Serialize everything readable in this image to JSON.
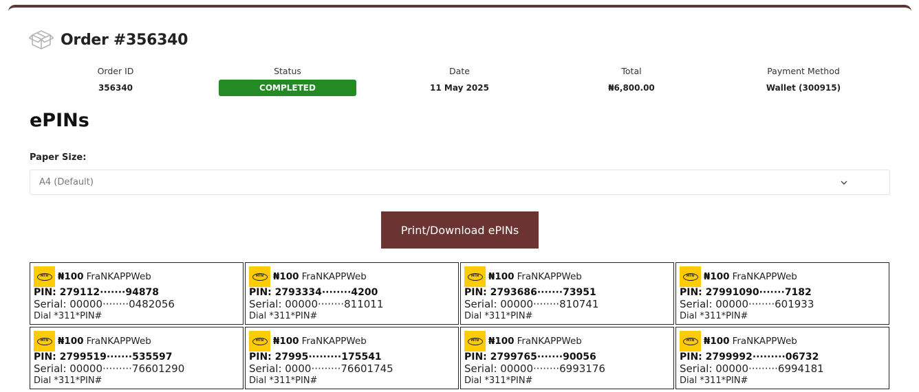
{
  "order": {
    "title": "Order #356340",
    "icon": "box-icon",
    "summary": {
      "order_id_label": "Order ID",
      "order_id": "356340",
      "status_label": "Status",
      "status": "COMPLETED",
      "status_color": "#248a24",
      "date_label": "Date",
      "date": "11 May 2025",
      "total_label": "Total",
      "total": "₦6,800.00",
      "payment_label": "Payment Method",
      "payment": "Wallet (300915)"
    }
  },
  "epins": {
    "title": "ePINs",
    "paper_size_label": "Paper Size:",
    "paper_size_value": "A4 (Default)",
    "print_button": "Print/Download ePINs",
    "accent_color": "#6b3331",
    "cards": [
      {
        "amount": "₦100",
        "vendor": "FraNKAPPWeb",
        "pin": "PIN: 279112·······94878",
        "serial": "Serial: 00000········0482056",
        "dial": "Dial *311*PIN#"
      },
      {
        "amount": "₦100",
        "vendor": "FraNKAPPWeb",
        "pin": "PIN: 2793334········4200",
        "serial": "Serial: 00000········811011",
        "dial": "Dial *311*PIN#"
      },
      {
        "amount": "₦100",
        "vendor": "FraNKAPPWeb",
        "pin": "PIN: 2793686·······73951",
        "serial": "Serial: 00000········810741",
        "dial": "Dial *311*PIN#"
      },
      {
        "amount": "₦100",
        "vendor": "FraNKAPPWeb",
        "pin": "PIN: 27991090·······7182",
        "serial": "Serial: 00000········601933",
        "dial": "Dial *311*PIN#"
      },
      {
        "amount": "₦100",
        "vendor": "FraNKAPPWeb",
        "pin": "PIN: 2799519·······535597",
        "serial": "Serial: 00000·········76601290",
        "dial": "Dial *311*PIN#"
      },
      {
        "amount": "₦100",
        "vendor": "FraNKAPPWeb",
        "pin": "PIN: 27995·········175541",
        "serial": "Serial: 0000·········76601745",
        "dial": "Dial *311*PIN#"
      },
      {
        "amount": "₦100",
        "vendor": "FraNKAPPWeb",
        "pin": "PIN: 2799765·······90056",
        "serial": "Serial: 00000········6993176",
        "dial": "Dial *311*PIN#"
      },
      {
        "amount": "₦100",
        "vendor": "FraNKAPPWeb",
        "pin": "PIN: 2799992·········06732",
        "serial": "Serial: 00000·········6994181",
        "dial": "Dial *311*PIN#"
      }
    ]
  },
  "brand": {
    "mtn_logo_text": "MTN",
    "mtn_color": "#ffcb05"
  }
}
